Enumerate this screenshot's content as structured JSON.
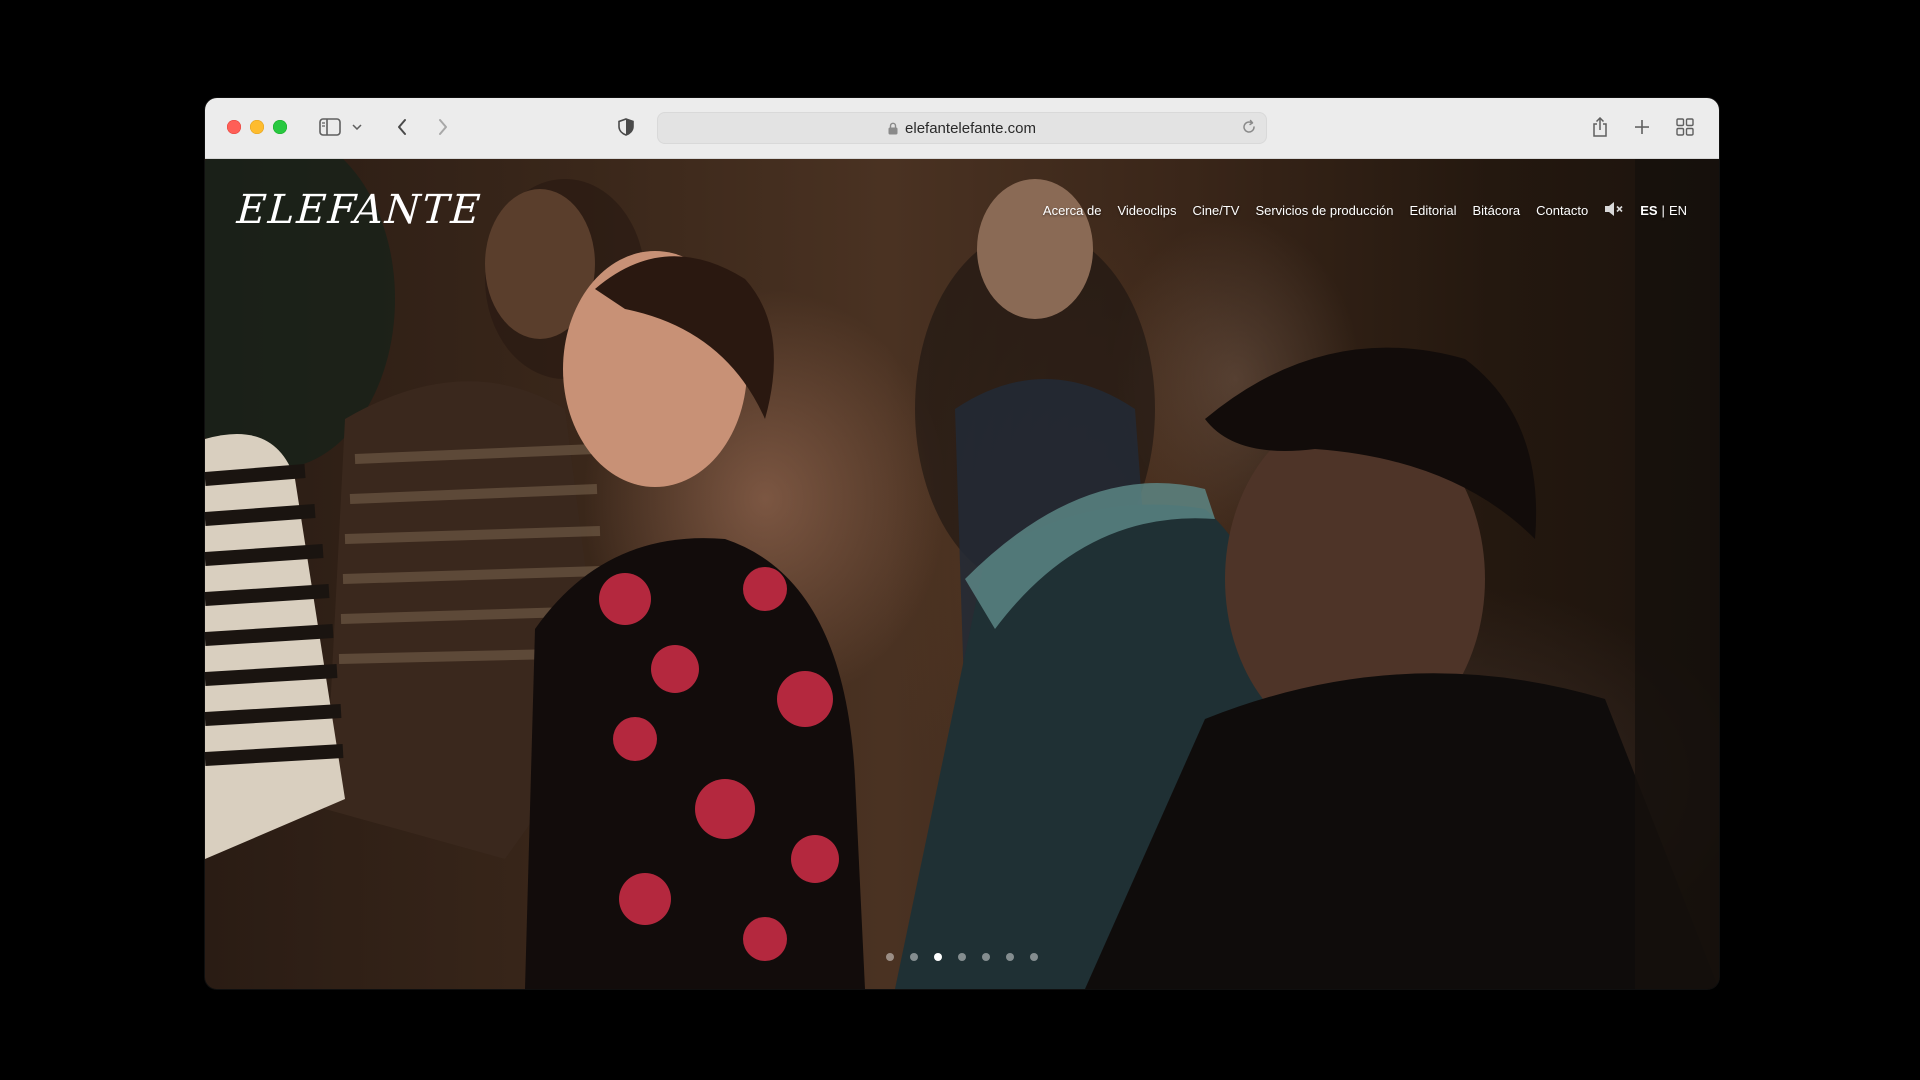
{
  "browser": {
    "address": "elefantelefante.com",
    "icons": {
      "sidebar": "sidebar-icon",
      "back": "chevron-left-icon",
      "forward": "chevron-right-icon",
      "privacy": "shield-icon",
      "lock": "lock-icon",
      "reload": "reload-icon",
      "share": "share-icon",
      "new_tab": "plus-icon",
      "tabs": "grid-icon"
    }
  },
  "site": {
    "logo": "ELEFANTE",
    "nav": [
      {
        "label": "Acerca de"
      },
      {
        "label": "Videoclips"
      },
      {
        "label": "Cine/TV"
      },
      {
        "label": "Servicios de producción"
      },
      {
        "label": "Editorial"
      },
      {
        "label": "Bitácora"
      },
      {
        "label": "Contacto"
      }
    ],
    "mute_icon": "speaker-muted-icon",
    "lang": {
      "es": "ES",
      "separator": "|",
      "en": "EN",
      "active": "es"
    },
    "slider": {
      "count": 7,
      "active_index": 2
    }
  },
  "colors": {
    "close": "#ff5f57",
    "minimize": "#febc2e",
    "zoom": "#28c840",
    "toolbar_bg": "#ececec"
  }
}
